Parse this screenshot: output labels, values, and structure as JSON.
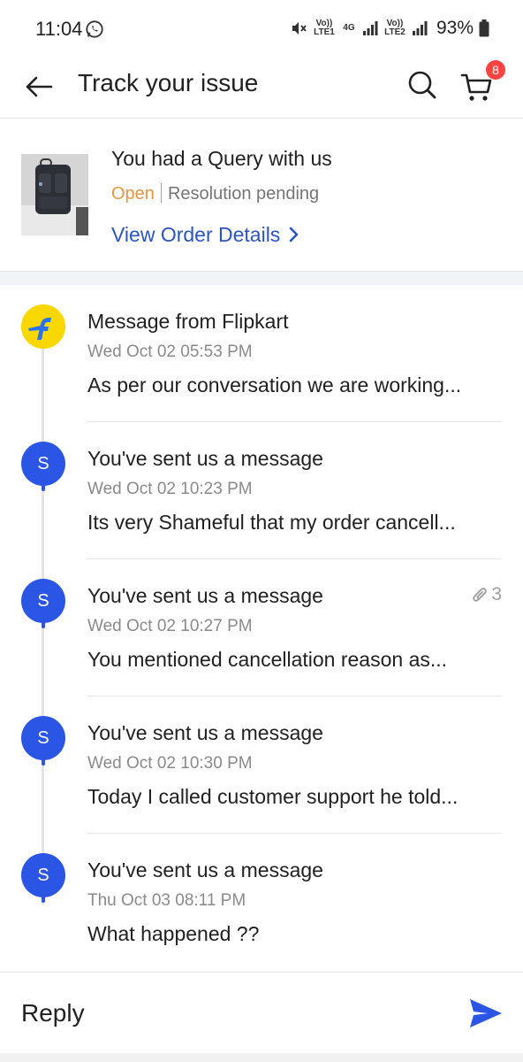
{
  "status_bar": {
    "time": "11:04",
    "whatsapp_icon": "whatsapp-icon",
    "sim1_label": "Vo)) LTE1",
    "network_label": "4G",
    "sim2_label": "Vo)) LTE2",
    "battery": "93%"
  },
  "header": {
    "title": "Track your issue",
    "cart_count": "8"
  },
  "order": {
    "title": "You had a Query with us",
    "status": "Open",
    "resolution": "Resolution pending",
    "link": "View Order Details"
  },
  "messages": [
    {
      "sender": "flipkart",
      "title": "Message from Flipkart",
      "time": "Wed Oct 02 05:53 PM",
      "preview": "As per our conversation we are working..."
    },
    {
      "sender": "S",
      "title": "You've sent us a message",
      "time": "Wed Oct 02 10:23 PM",
      "preview": "Its very Shameful that my order cancell..."
    },
    {
      "sender": "S",
      "title": "You've sent us a message",
      "time": "Wed Oct 02 10:27 PM",
      "preview": "You mentioned cancellation reason as...",
      "attachments": "3"
    },
    {
      "sender": "S",
      "title": "You've sent us a message",
      "time": "Wed Oct 02 10:30 PM",
      "preview": "Today I called customer support he told..."
    },
    {
      "sender": "S",
      "title": "You've sent us a message",
      "time": "Thu Oct 03 08:11 PM",
      "preview": "What happened ??"
    }
  ],
  "reply": {
    "placeholder": "Reply"
  },
  "colors": {
    "accent_blue": "#2a55c4",
    "avatar_blue": "#2a55e5",
    "status_open": "#e8953e",
    "badge_red": "#ff4343",
    "flipkart_yellow": "#f8d800"
  }
}
